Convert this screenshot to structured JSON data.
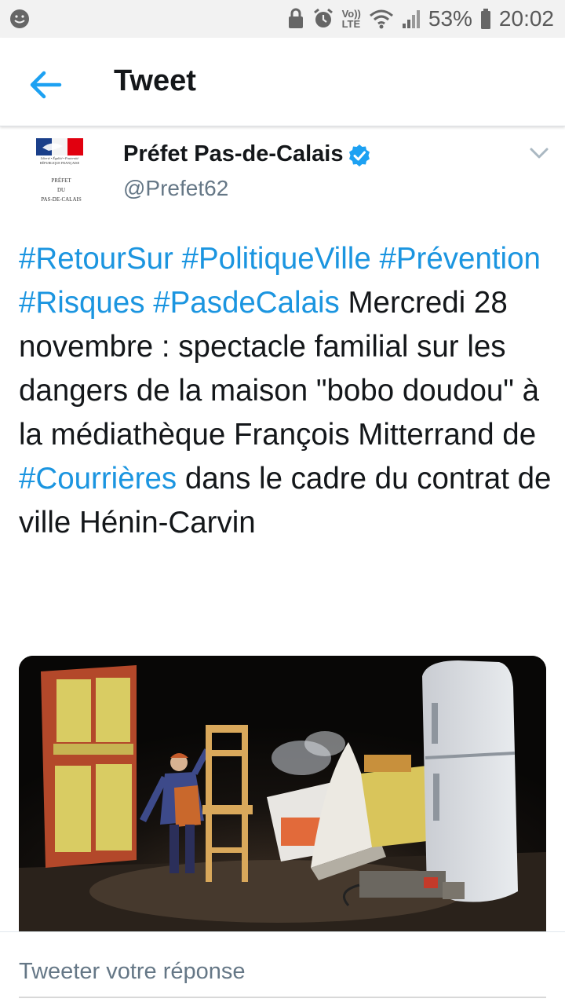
{
  "status_bar": {
    "battery": "53%",
    "time": "20:02",
    "network": "LTE",
    "volte": "Vo))"
  },
  "header": {
    "title": "Tweet"
  },
  "tweet": {
    "author_name": "Préfet Pas-de-Calais",
    "author_handle": "@Prefet62",
    "avatar_text": {
      "line1": "PRÉFET",
      "line2": "DU",
      "line3": "PAS-DE-CALAIS",
      "motto": "Liberté • Égalité • Fraternité",
      "republic": "RÉPUBLIQUE FRANÇAISE"
    },
    "text_parts": [
      {
        "text": "#RetourSur",
        "tag": true
      },
      {
        "text": " ",
        "tag": false
      },
      {
        "text": "#PolitiqueVille",
        "tag": true
      },
      {
        "text": " ",
        "tag": false
      },
      {
        "text": "#Prévention",
        "tag": true
      },
      {
        "text": " ",
        "tag": false
      },
      {
        "text": "#Risques",
        "tag": true
      },
      {
        "text": " ",
        "tag": false
      },
      {
        "text": "#PasdeCalais",
        "tag": true
      },
      {
        "text": " Mercredi 28 novembre : spectacle familial sur les dangers de la maison \"bobo doudou\" à la médiathèque Fran­çois Mitterrand de ",
        "tag": false
      },
      {
        "text": "#Courrières",
        "tag": true
      },
      {
        "text": " dans le cadre du contrat de ville Hénin-Carvin",
        "tag": false
      }
    ]
  },
  "reply": {
    "placeholder": "Tweeter votre réponse"
  },
  "colors": {
    "hashtag": "#1b95e0",
    "verified": "#1da1f2",
    "back_arrow": "#1da1f2"
  },
  "icons": {
    "back": "arrow-left-icon",
    "verified": "verified-badge-icon",
    "caret": "chevron-down-icon"
  }
}
